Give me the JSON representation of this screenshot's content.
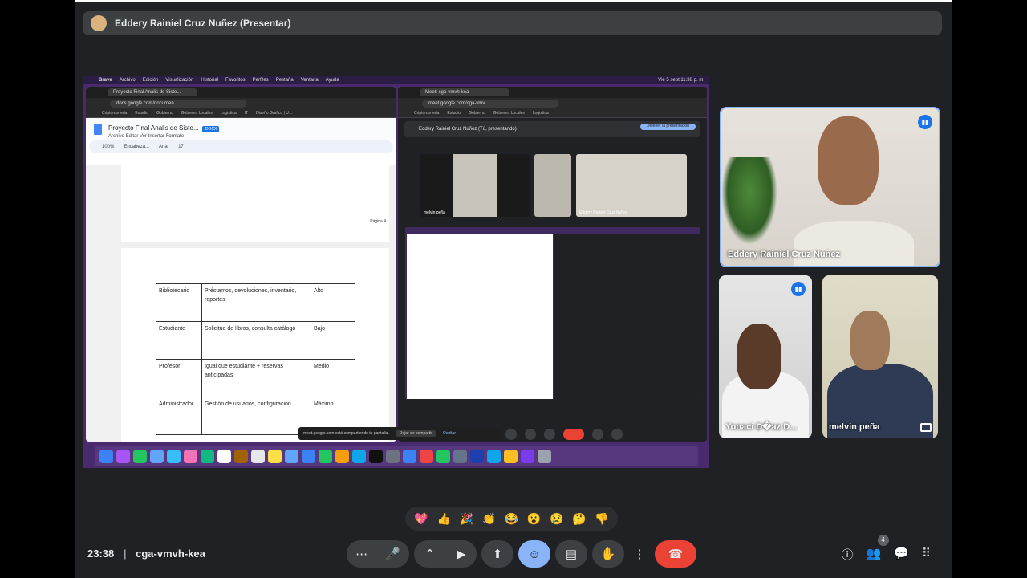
{
  "presenter_bar": {
    "name": "Eddery Rainiel Cruz Nuñez (Presentar)"
  },
  "share": {
    "mac_menu": [
      "Brave",
      "Archivo",
      "Edición",
      "Visualización",
      "Historial",
      "Favoritos",
      "Perfiles",
      "Pestaña",
      "Ventana",
      "Ayuda"
    ],
    "mac_clock": "Vie 5 sept 11:38 p. m.",
    "left_window": {
      "tab_title": "Proyecto Final Analis de Siste...",
      "url": "docs.google.com/documen...",
      "bookmarks": [
        "Criptomoneda",
        "Estudio",
        "Gobierno",
        "Gobierno Locales",
        "Logistica",
        "IT",
        "Diseño Grafico | U..."
      ],
      "doc_title": "Proyecto Final Analis de Siste...",
      "docx_badge": ".DOCX",
      "doc_menu": "Archivo  Editar  Ver  Insertar  Formato",
      "toolbar": {
        "zoom": "100%",
        "style": "Encabeza...",
        "font": "Arial",
        "size": "17"
      },
      "pagina_label": "Página 4",
      "table": [
        {
          "role": "Bibliotecario",
          "desc": "Préstamos, devoluciones, inventario, reportes",
          "level": "Alto"
        },
        {
          "role": "Estudiante",
          "desc": "Solicitud de libros, consulta catálogo",
          "level": "Bajo"
        },
        {
          "role": "Profesor",
          "desc": "Igual que estudiante + reservas anticipadas",
          "level": "Medio"
        },
        {
          "role": "Administrador",
          "desc": "Gestión de usuarios, configuración",
          "level": "Máximo"
        }
      ]
    },
    "right_window": {
      "tab_title": "Meet: cga-vmvh-kea",
      "url": "meet.google.com/cga-vmv...",
      "presenting_text": "Eddery Rainiel Cruz Nuñez (Tú, presentando)",
      "stop_button": "Detener la presentación",
      "mini_tiles": [
        "melvin peña",
        "",
        "Eddery Rainiel Cruz Nuñez"
      ]
    },
    "toast": {
      "text": "meet.google.com está compartiendo tu pantalla.",
      "stop": "Dejar de compartir",
      "hide": "Ocultar"
    }
  },
  "participants": {
    "main": "Eddery Rainiel Cruz Nuñez",
    "tile_a": "Yonaci D�az D...",
    "tile_b": "melvin peña"
  },
  "reactions": [
    "💖",
    "👍",
    "🎉",
    "👏",
    "😂",
    "😮",
    "😢",
    "🤔",
    "👎"
  ],
  "bottom": {
    "time": "23:38",
    "separator": "|",
    "meeting_code": "cga-vmvh-kea",
    "participant_count": "4"
  },
  "colors": {
    "accent": "#8ab4f8",
    "end_call": "#ea4335",
    "bg": "#202124"
  }
}
